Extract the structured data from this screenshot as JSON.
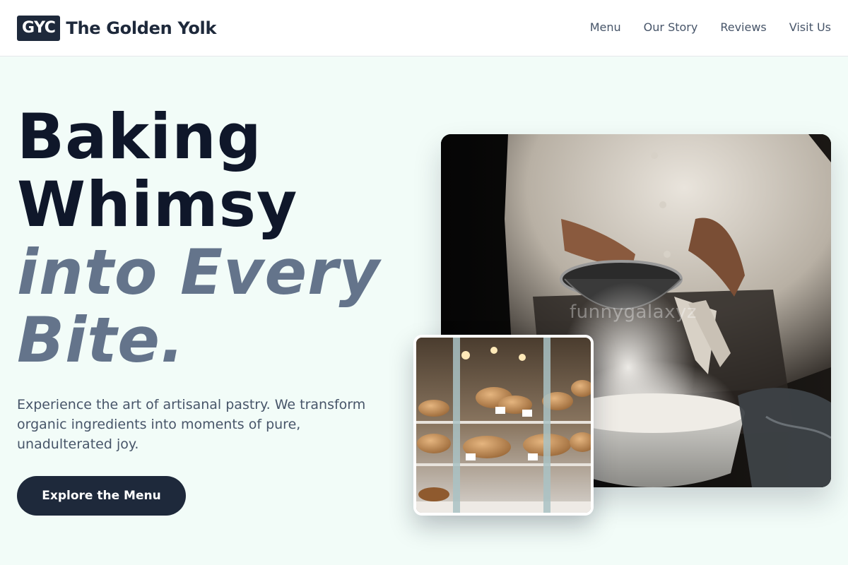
{
  "header": {
    "brand_badge": "GYC",
    "brand_name": "The Golden Yolk",
    "nav": [
      {
        "label": "Menu"
      },
      {
        "label": "Our Story"
      },
      {
        "label": "Reviews"
      },
      {
        "label": "Visit Us"
      }
    ]
  },
  "hero": {
    "headline_line1": "Baking",
    "headline_line2": "Whimsy",
    "headline_line3": "into Every",
    "headline_line4": "Bite.",
    "intro": "Experience the art of artisanal pastry. We transform organic ingredients into moments of pure, unadulterated joy.",
    "cta_label": "Explore the Menu"
  },
  "images": {
    "main": {
      "subject": "baker sifting flour into a bowl",
      "watermark": "funnygalaxyz"
    },
    "secondary": {
      "subject": "bakery display case with breads and pastries"
    }
  },
  "colors": {
    "background": "#f2fcf8",
    "primary_dark": "#1e293b",
    "headline_dark": "#0f172a",
    "headline_muted": "#64748b",
    "body_text": "#475569"
  }
}
